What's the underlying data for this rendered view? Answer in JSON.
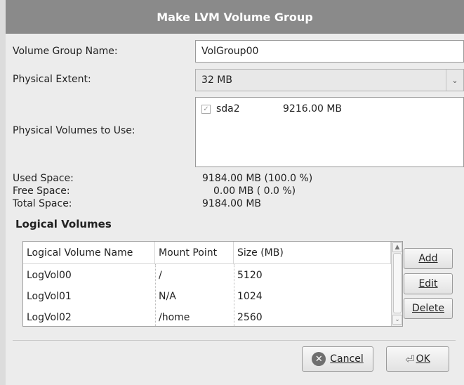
{
  "window": {
    "title": "Make LVM Volume Group"
  },
  "form": {
    "vg_name_label": "Volume Group Name:",
    "vg_name_value": "VolGroup00",
    "extent_label": "Physical Extent:",
    "extent_value": "32 MB",
    "pv_label": "Physical Volumes to Use:",
    "pv_items": [
      {
        "checked": true,
        "device": "sda2",
        "size": "9216.00 MB"
      }
    ]
  },
  "space": {
    "used_label": "Used Space:",
    "used_value": "9184.00 MB  (100.0 %)",
    "free_label": "Free Space:",
    "free_value": "0.00 MB  ( 0.0 %)",
    "total_label": "Total Space:",
    "total_value": "9184.00 MB"
  },
  "logical_volumes": {
    "heading": "Logical Volumes",
    "columns": [
      "Logical Volume Name",
      "Mount Point",
      "Size (MB)"
    ],
    "rows": [
      {
        "name": "LogVol00",
        "mount": "/",
        "size": "5120"
      },
      {
        "name": "LogVol01",
        "mount": "N/A",
        "size": "1024"
      },
      {
        "name": "LogVol02",
        "mount": "/home",
        "size": "2560"
      }
    ]
  },
  "buttons": {
    "add": "Add",
    "edit": "Edit",
    "delete": "Delete",
    "cancel": "Cancel",
    "ok": "OK"
  },
  "icons": {
    "cancel": "cancel-circle-icon",
    "ok": "ok-arrow-icon",
    "dropdown": "chevron-down-icon"
  }
}
